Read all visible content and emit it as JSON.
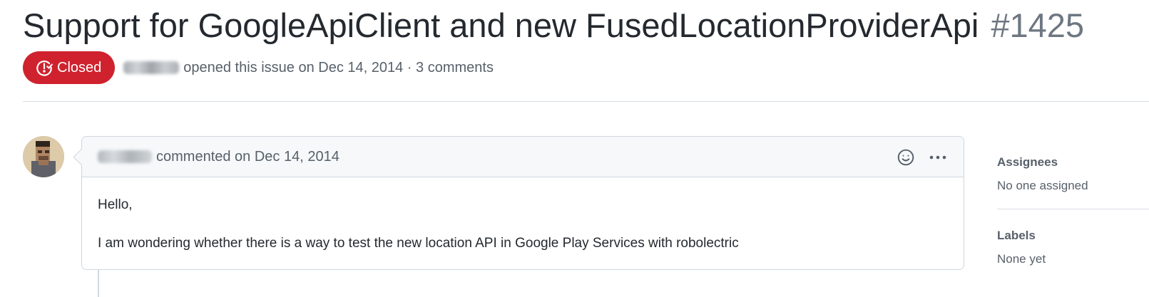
{
  "issue": {
    "title": "Support for GoogleApiClient and new FusedLocationProviderApi",
    "number": "#1425",
    "state": "Closed",
    "state_color": "#cf222e",
    "meta": "opened this issue on Dec 14, 2014 · 3 comments"
  },
  "comment": {
    "meta": "commented on Dec 14, 2014",
    "body": [
      "Hello,",
      "I am wondering whether there is a way to test the new location API in Google Play Services with robolectric"
    ],
    "actions": {
      "reaction_icon": "smiley-icon",
      "more_icon": "kebab-horizontal-icon"
    }
  },
  "sidebar": {
    "assignees": {
      "heading": "Assignees",
      "value": "No one assigned"
    },
    "labels": {
      "heading": "Labels",
      "value": "None yet"
    }
  }
}
